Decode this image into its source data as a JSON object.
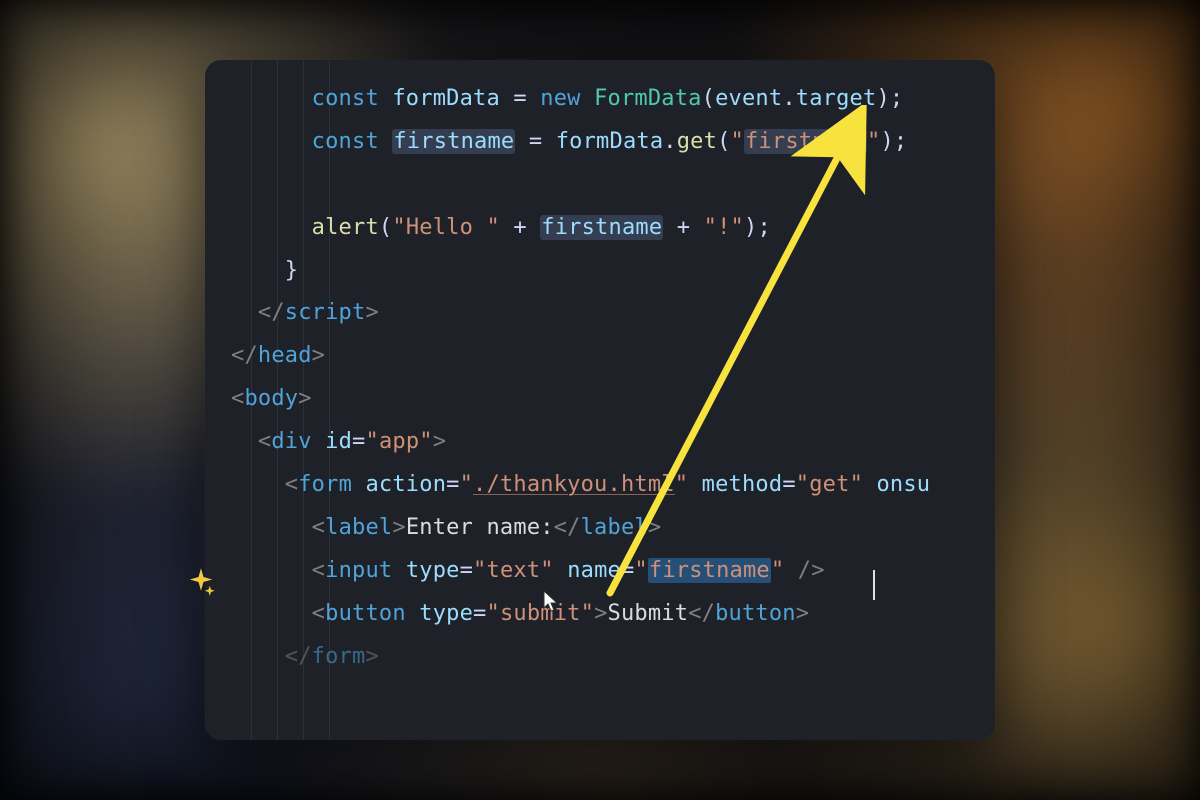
{
  "code": {
    "line1": {
      "kw": "const",
      "var": "formData",
      "eq": " = ",
      "new": "new",
      "cls": "FormData",
      "open": "(",
      "argA": "event",
      "dot": ".",
      "argB": "target",
      "close": ");"
    },
    "line2": {
      "kw": "const",
      "var": "firstname",
      "eq": " = ",
      "obj": "formData",
      "dot": ".",
      "fn": "get",
      "open": "(",
      "q1": "\"",
      "str": "firstname",
      "q2": "\"",
      "close": ");"
    },
    "line3": {
      "blank": " "
    },
    "line4": {
      "fn": "alert",
      "open": "(",
      "q1": "\"",
      "str1": "Hello ",
      "q2": "\"",
      "plus1": " + ",
      "var": "firstname",
      "plus2": " + ",
      "q3": "\"",
      "str2": "!",
      "q4": "\"",
      "close": ");"
    },
    "line5": {
      "brace": "}"
    },
    "line6": {
      "lt": "</",
      "tag": "script",
      "gt": ">"
    },
    "line7": {
      "lt": "</",
      "tag": "head",
      "gt": ">"
    },
    "line8": {
      "lt": "<",
      "tag": "body",
      "gt": ">"
    },
    "line9": {
      "lt": "<",
      "tag": "div",
      "sp": " ",
      "attr": "id",
      "eq": "=",
      "q1": "\"",
      "val": "app",
      "q2": "\"",
      "gt": ">"
    },
    "line10": {
      "lt": "<",
      "tag": "form",
      "sp": " ",
      "a1": "action",
      "eq1": "=",
      "q1a": "\"",
      "v1": "./thankyou.html",
      "q1b": "\"",
      "sp2": " ",
      "a2": "method",
      "eq2": "=",
      "q2a": "\"",
      "v2": "get",
      "q2b": "\"",
      "sp3": " ",
      "a3": "onsu"
    },
    "line11": {
      "lt": "<",
      "tag": "label",
      "gt": ">",
      "text": "Enter name:",
      "lt2": "</",
      "tag2": "label",
      "gt2": ">"
    },
    "line12": {
      "lt": "<",
      "tag": "input",
      "sp": " ",
      "a1": "type",
      "eq1": "=",
      "q1a": "\"",
      "v1": "text",
      "q1b": "\"",
      "sp2": " ",
      "a2": "name",
      "eq2": "=",
      "q2a": "\"",
      "v2": "firstname",
      "q2b": "\"",
      "sp3": " ",
      "slash": "/>",
      "end": ""
    },
    "line13": {
      "lt": "<",
      "tag": "button",
      "sp": " ",
      "a1": "type",
      "eq1": "=",
      "q1a": "\"",
      "v1": "submit",
      "q1b": "\"",
      "gt": ">",
      "text": "Submit",
      "lt2": "</",
      "tag2": "button",
      "gt2": ">"
    },
    "line14": {
      "lt": "</",
      "tag": "form",
      "gt": ">"
    }
  }
}
